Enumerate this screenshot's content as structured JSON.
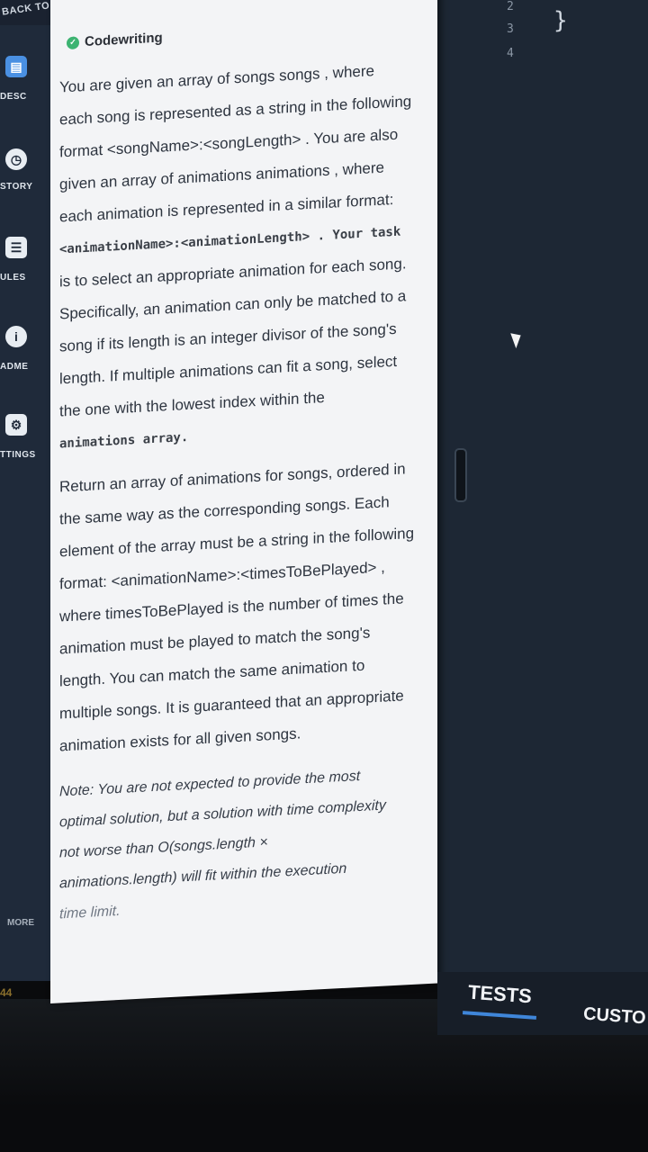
{
  "nav": {
    "back_label": "BACK TO",
    "items": [
      {
        "label": "DESC",
        "icon": "document-icon"
      },
      {
        "label": "STORY",
        "icon": "clock-icon"
      },
      {
        "label": "ULES",
        "icon": "list-icon"
      },
      {
        "label": "ADME",
        "icon": "info-icon"
      },
      {
        "label": "TTINGS",
        "icon": "gear-icon"
      }
    ],
    "more_label": "MORE",
    "counter": "44"
  },
  "panel": {
    "brand": "Codewriting",
    "p1_lines": [
      "You are given an array of songs songs , where",
      "each song is represented as a string in the following",
      "format <songName>:<songLength> . You are also",
      "given an array of animations animations , where",
      "each animation is represented in a similar format:",
      "<animationName>:<animationLength> . Your task",
      "is to select an appropriate animation for each song.",
      "Specifically, an animation can only be matched to a",
      "song if its length is an integer divisor of the song's",
      "length. If multiple animations can fit a song, select",
      "the one with the lowest index within the",
      "animations array."
    ],
    "p2_lines": [
      "Return an array of animations for songs, ordered in",
      "the same way as the corresponding songs. Each",
      "element of the array must be a string in the following",
      "format: <animationName>:<timesToBePlayed> ,",
      "where timesToBePlayed is the number of times the",
      "animation must be played to match the song's",
      "length. You can match the same animation to",
      "multiple songs. It is guaranteed that an appropriate",
      "animation exists for all given songs."
    ],
    "note_lines": [
      "Note: You are not expected to provide the most",
      "optimal solution, but a solution with time complexity",
      "not worse than O(songs.length ×",
      "animations.length) will fit within the execution",
      "time limit."
    ]
  },
  "editor": {
    "line_numbers": [
      "2",
      "3",
      "4"
    ],
    "closing_brace": "}"
  },
  "tabs": {
    "tests_label": "TESTS",
    "custom_label": "CUSTO"
  }
}
